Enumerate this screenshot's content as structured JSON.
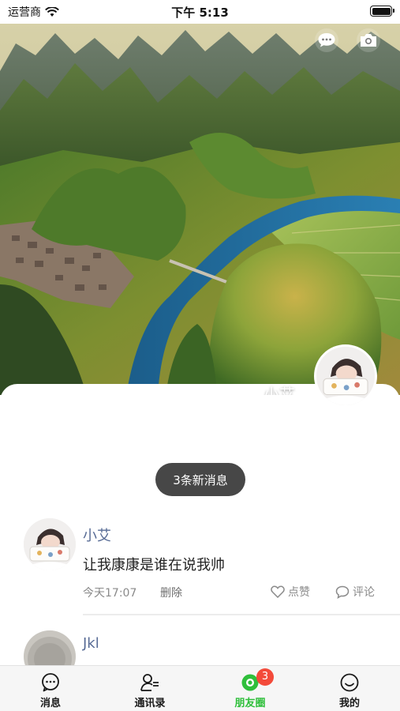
{
  "status_bar": {
    "carrier": "运营商",
    "time": "下午 5:13"
  },
  "cover": {
    "user_name": "小艾"
  },
  "feed": {
    "new_messages_label": "3条新消息",
    "posts": [
      {
        "author": "小艾",
        "content": "让我康康是谁在说我帅",
        "time": "今天17:07",
        "delete_label": "删除",
        "like_label": "点赞",
        "comment_label": "评论"
      },
      {
        "author": "Jkl"
      }
    ]
  },
  "tabbar": {
    "tabs": [
      {
        "label": "消息",
        "icon": "chat-icon"
      },
      {
        "label": "通讯录",
        "icon": "contacts-icon"
      },
      {
        "label": "朋友圈",
        "icon": "moments-icon",
        "badge": "3",
        "active": true
      },
      {
        "label": "我的",
        "icon": "smile-icon"
      }
    ]
  },
  "colors": {
    "accent": "#2fbf3b",
    "author": "#576b95",
    "badge": "#f34a3a"
  }
}
